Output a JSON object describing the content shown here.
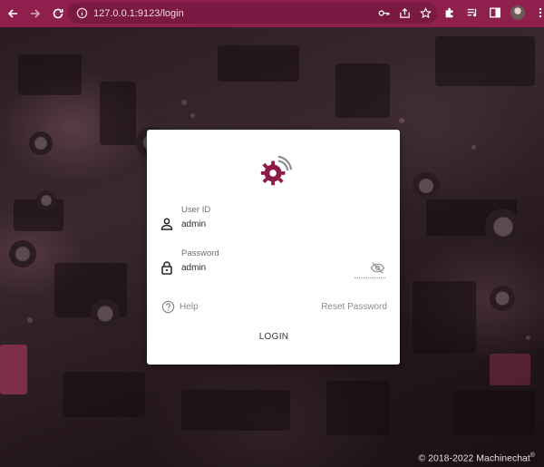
{
  "browser": {
    "url": "127.0.0.1:9123/login",
    "icons": [
      "back-arrow-icon",
      "forward-arrow-icon",
      "reload-icon",
      "site-info-icon",
      "key-icon",
      "share-icon",
      "bookmark-star-icon",
      "extensions-puzzle-icon",
      "media-queue-icon",
      "side-panel-icon",
      "profile-avatar-icon"
    ],
    "accent": "#8f1f4d"
  },
  "login": {
    "user_label": "User ID",
    "user_value": "admin",
    "password_label": "Password",
    "password_value": "admin",
    "help_label": "Help",
    "reset_label": "Reset Password",
    "login_label": "LOGIN",
    "brand_color": "#8e1a47"
  },
  "footer": {
    "copyright": "© 2018-2022 Machinechat",
    "mark": "®"
  }
}
